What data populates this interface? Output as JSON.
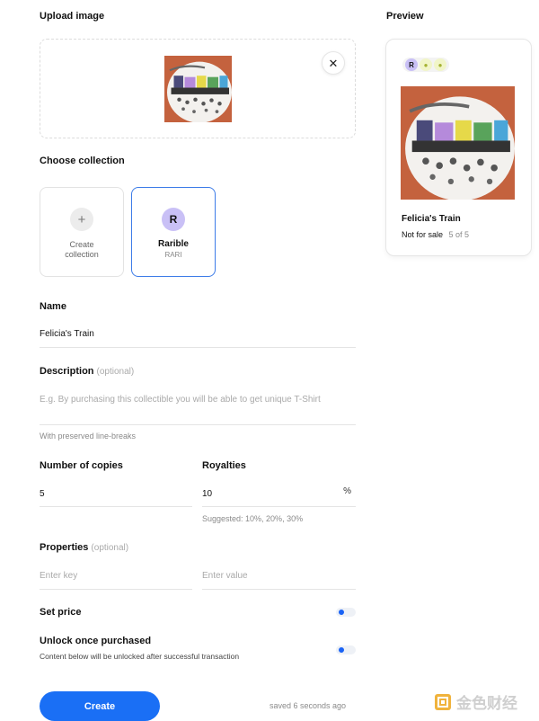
{
  "upload": {
    "heading": "Upload image"
  },
  "preview": {
    "heading": "Preview",
    "title": "Felicia's Train",
    "status": "Not for sale",
    "count": "5 of 5"
  },
  "collection": {
    "heading": "Choose collection",
    "create_label": "Create collection",
    "create_icon": "+",
    "rarible_name": "Rarible",
    "rarible_ticker": "RARI",
    "rarible_icon": "R"
  },
  "form": {
    "name_label": "Name",
    "name_value": "Felicia's Train",
    "description_label": "Description",
    "description_optional": "(optional)",
    "description_placeholder": "E.g. By purchasing this collectible you will be able to get unique T-Shirt",
    "description_hint": "With preserved line-breaks",
    "copies_label": "Number of copies",
    "copies_value": "5",
    "royalties_label": "Royalties",
    "royalties_value": "10",
    "royalties_unit": "%",
    "royalties_hint": "Suggested: 10%, 20%, 30%",
    "properties_label": "Properties",
    "properties_optional": "(optional)",
    "key_placeholder": "Enter key",
    "value_placeholder": "Enter value",
    "set_price_label": "Set price",
    "unlock_label": "Unlock once purchased",
    "unlock_hint": "Content below will be unlocked after successful transaction"
  },
  "toggles": {
    "set_price": true,
    "unlock": true
  },
  "footer": {
    "create_label": "Create",
    "saved_status": "saved 6 seconds ago"
  },
  "watermark": {
    "text": "金色财经"
  },
  "colors": {
    "accent": "#1a6ff5",
    "selected_border": "#3d7ce8",
    "art_background": "#c4623e",
    "watermark_logo": "#f0b33c"
  }
}
